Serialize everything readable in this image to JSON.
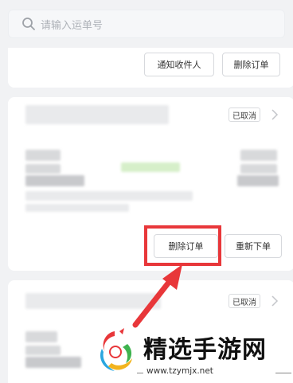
{
  "search": {
    "placeholder": "请输入运单号",
    "icon": "search-icon"
  },
  "top_card": {
    "notify_button": "通知收件人",
    "delete_button": "删除订单"
  },
  "order_card_1": {
    "status": "已取消",
    "delete_button": "删除订单",
    "reorder_button": "重新下单"
  },
  "order_card_2": {
    "status": "已取消"
  },
  "annotation": {
    "highlight_color": "#e8373a"
  },
  "watermark": {
    "title": "精选手游网",
    "url": "www.tzymjx.net"
  }
}
